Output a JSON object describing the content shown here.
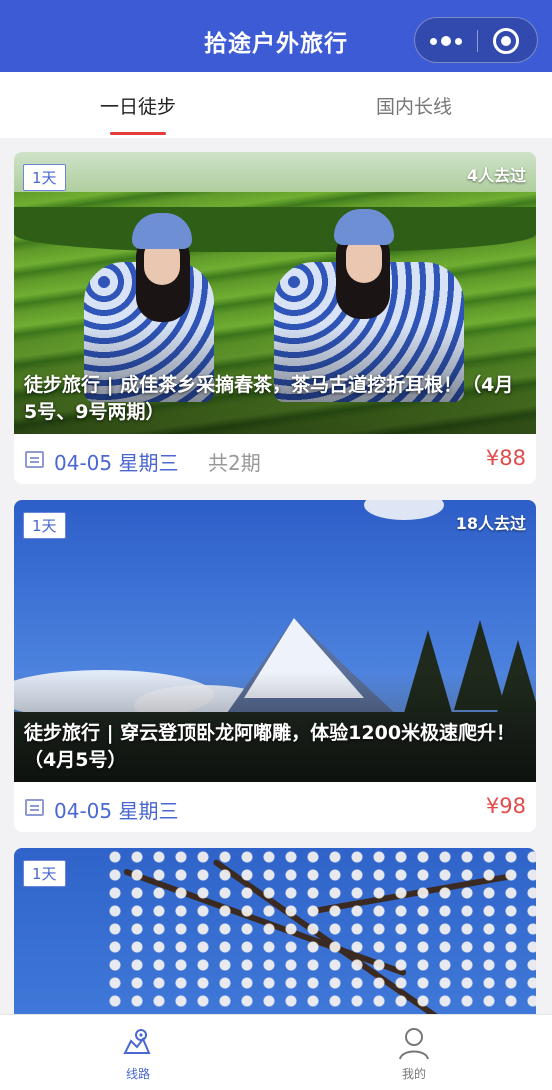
{
  "header": {
    "title": "拾途户外旅行",
    "menu_icon": "more-dots-icon",
    "close_icon": "target-circle-icon",
    "color": "#3d5bd4"
  },
  "tabs": [
    {
      "label": "一日徒步",
      "active": true
    },
    {
      "label": "国内长线",
      "active": false
    }
  ],
  "trips": [
    {
      "days": "1天",
      "visitors": "4人去过",
      "title": "徒步旅行 | 成佳茶乡采摘春茶，茶马古道挖折耳根！（4月5号、9号两期）",
      "date": "04-05 星期三",
      "periods": "共2期",
      "price": "¥88"
    },
    {
      "days": "1天",
      "visitors": "18人去过",
      "title": "徒步旅行 | 穿云登顶卧龙阿嘟雕，体验1200米极速爬升！（4月5号）",
      "date": "04-05 星期三",
      "periods": "",
      "price": "¥98"
    },
    {
      "days": "1天"
    }
  ],
  "bottom_nav": [
    {
      "label": "线路",
      "icon": "route-map-icon",
      "active": true
    },
    {
      "label": "我的",
      "icon": "person-icon",
      "active": false
    }
  ],
  "colors": {
    "accent": "#4a67d2",
    "price": "#e24b4b",
    "tab_indicator": "#e23b3b"
  }
}
